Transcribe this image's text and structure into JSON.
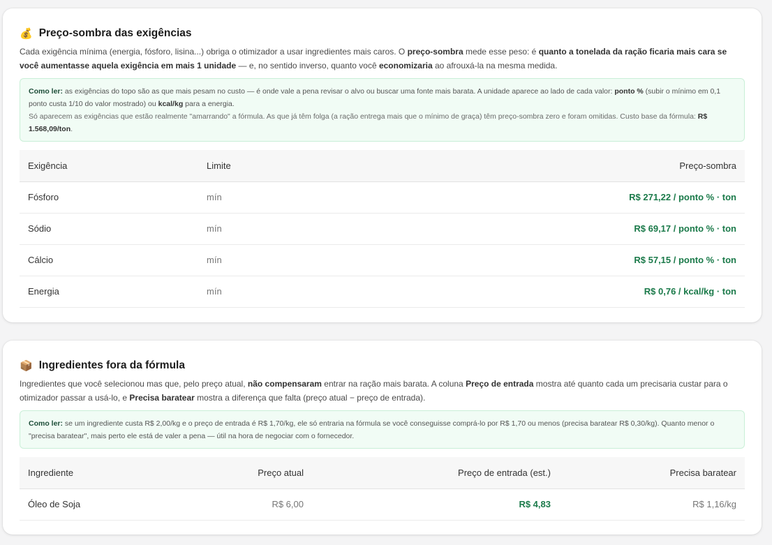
{
  "shadow": {
    "icon": "money-bag-icon",
    "title": "Preço-sombra das exigências",
    "desc_1": "Cada exigência mínima (energia, fósforo, lisina...) obriga o otimizador a usar ingredientes mais caros. O ",
    "desc_b1": "preço-sombra",
    "desc_2": " mede esse peso: é ",
    "desc_b2": "quanto a tonelada da ração ficaria mais cara se você aumentasse aquela exigência em mais 1 unidade",
    "desc_3": " — e, no sentido inverso, quanto você ",
    "desc_b3": "economizaria",
    "desc_4": " ao afrouxá-la na mesma medida.",
    "tip_label": "Como ler:",
    "tip_1": " as exigências do topo são as que mais pesam no custo — é onde vale a pena revisar o alvo ou buscar uma fonte mais barata. A unidade aparece ao lado de cada valor: ",
    "tip_b1": "ponto %",
    "tip_2": " (subir o mínimo em 0,1 ponto custa 1/10 do valor mostrado) ou ",
    "tip_b2": "kcal/kg",
    "tip_3": " para a energia.",
    "tip_4": "Só aparecem as exigências que estão realmente \"amarrando\" a fórmula. As que já têm folga (a ração entrega mais que o mínimo de graça) têm preço-sombra zero e foram omitidas. Custo base da fórmula: ",
    "tip_b3": "R$ 1.568,09/ton",
    "tip_5": ".",
    "headers": [
      "Exigência",
      "Limite",
      "Preço-sombra"
    ],
    "rows": [
      {
        "name": "Fósforo",
        "limit": "mín",
        "price": "R$ 271,22 / ponto % · ton"
      },
      {
        "name": "Sódio",
        "limit": "mín",
        "price": "R$ 69,17 / ponto % · ton"
      },
      {
        "name": "Cálcio",
        "limit": "mín",
        "price": "R$ 57,15 / ponto % · ton"
      },
      {
        "name": "Energia",
        "limit": "mín",
        "price": "R$ 0,76 / kcal/kg · ton"
      }
    ]
  },
  "excluded": {
    "icon": "package-icon",
    "title": "Ingredientes fora da fórmula",
    "desc_1": "Ingredientes que você selecionou mas que, pelo preço atual, ",
    "desc_b1": "não compensaram",
    "desc_2": " entrar na ração mais barata. A coluna ",
    "desc_b2": "Preço de entrada",
    "desc_3": " mostra até quanto cada um precisaria custar para o otimizador passar a usá-lo, e ",
    "desc_b3": "Precisa baratear",
    "desc_4": " mostra a diferença que falta (preço atual − preço de entrada).",
    "tip_label": "Como ler:",
    "tip_1": " se um ingrediente custa R$ 2,00/kg e o preço de entrada é R$ 1,70/kg, ele só entraria na fórmula se você conseguisse comprá-lo por R$ 1,70 ou menos (precisa baratear R$ 0,30/kg). Quanto menor o \"precisa baratear\", mais perto ele está de valer a pena — útil na hora de negociar com o fornecedor.",
    "headers": [
      "Ingrediente",
      "Preço atual",
      "Preço de entrada (est.)",
      "Precisa baratear"
    ],
    "rows": [
      {
        "name": "Óleo de Soja",
        "current": "R$ 6,00",
        "entry": "R$ 4,83",
        "diff": "R$ 1,16/kg"
      }
    ]
  },
  "colors": {
    "accent_green": "#1b7a4a",
    "tip_bg": "#f1fcf5",
    "tip_border": "#c9efd7"
  }
}
